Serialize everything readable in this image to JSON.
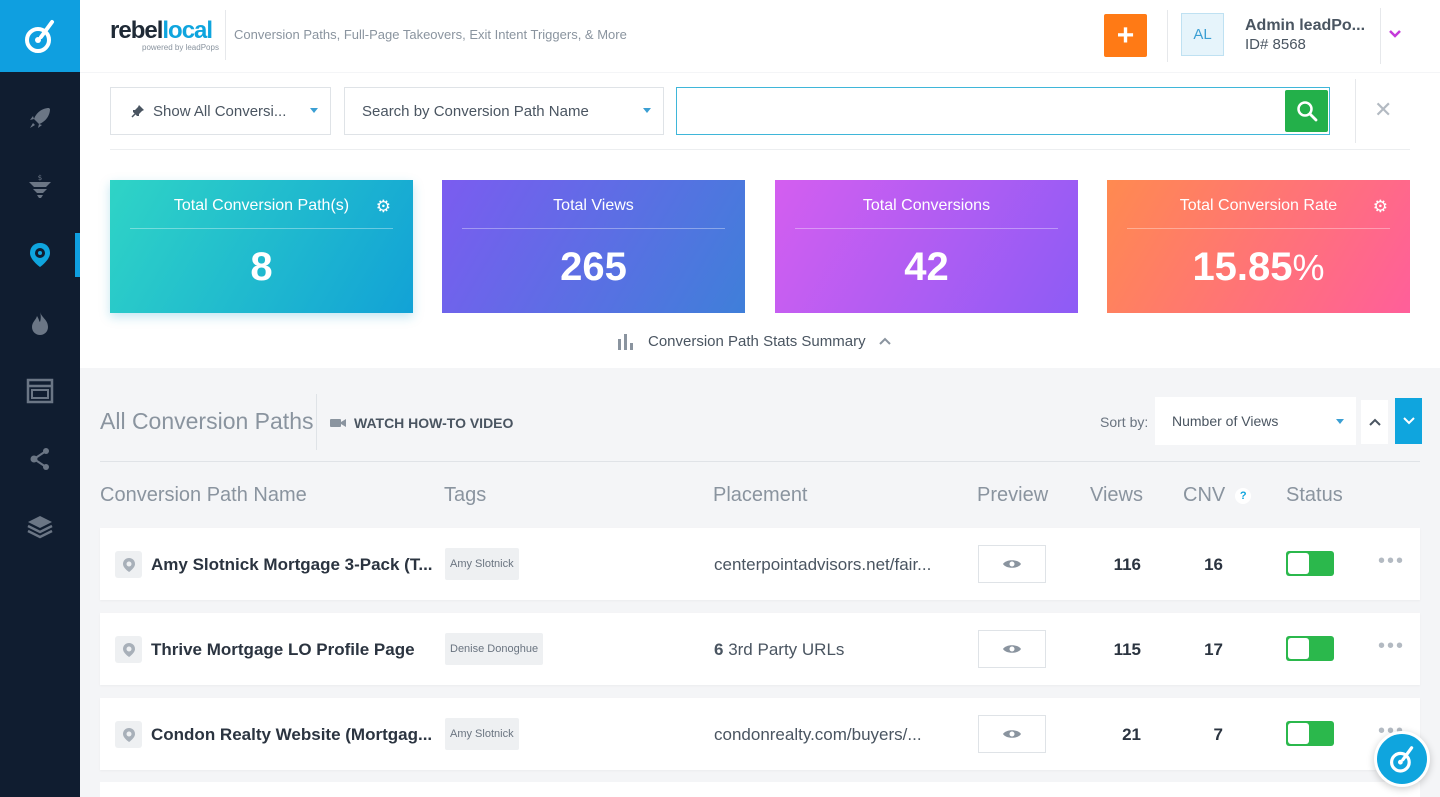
{
  "app": {
    "brand_name_a": "rebel",
    "brand_name_b": "local",
    "brand_sub": "powered by leadPops",
    "tagline": "Conversion Paths, Full-Page Takeovers, Exit Intent Triggers, & More",
    "add_label": "+"
  },
  "user": {
    "initials": "AL",
    "name": "Admin leadPo...",
    "id": "ID# 8568"
  },
  "sidebar": {
    "items": [
      {
        "icon": "rocket-icon"
      },
      {
        "icon": "funnel-icon"
      },
      {
        "icon": "conversion-path-icon",
        "active": true
      },
      {
        "icon": "flame-icon"
      },
      {
        "icon": "browser-window-icon"
      },
      {
        "icon": "share-network-icon"
      },
      {
        "icon": "layers-icon"
      }
    ]
  },
  "filters": {
    "show_all": "Show All Conversi...",
    "search_by": "Search by Conversion Path Name",
    "search_placeholder": "",
    "close_label": "✕"
  },
  "stats": {
    "cards": [
      {
        "title": "Total Conversion Path(s)",
        "value": "8"
      },
      {
        "title": "Total Views",
        "value": "265"
      },
      {
        "title": "Total Conversions",
        "value": "42"
      },
      {
        "title": "Total Conversion Rate",
        "value": "15.85",
        "suffix": "%"
      }
    ],
    "summary_label": "Conversion Path Stats Summary"
  },
  "list": {
    "title": "All Conversion Paths",
    "watch_label": "WATCH HOW-TO VIDEO",
    "sort_by_label": "Sort by:",
    "sort_value": "Number of Views",
    "columns": {
      "name": "Conversion Path Name",
      "tags": "Tags",
      "placement": "Placement",
      "preview": "Preview",
      "views": "Views",
      "cnv": "CNV",
      "help": "?",
      "status": "Status"
    },
    "rows": [
      {
        "name": "Amy Slotnick Mortgage 3-Pack (T...",
        "tag": "Amy Slotnick",
        "placement_bold": "",
        "placement": "centerpointadvisors.net/fair...",
        "views": "116",
        "cnv": "16",
        "more": "•••"
      },
      {
        "name": "Thrive Mortgage LO Profile Page",
        "tag": "Denise Donoghue",
        "placement_bold": "6",
        "placement": " 3rd Party URLs",
        "views": "115",
        "cnv": "17",
        "more": "•••"
      },
      {
        "name": "Condon Realty Website (Mortgag...",
        "tag": "Amy Slotnick",
        "placement_bold": "",
        "placement": "condonrealty.com/buyers/...",
        "views": "21",
        "cnv": "7",
        "more": "•••"
      }
    ]
  },
  "colors": {
    "accent": "#0fa5de",
    "sidebar": "#101d30",
    "add_button": "#ff7a15",
    "toggle_on": "#2bb84c",
    "search_button": "#23b04a"
  }
}
